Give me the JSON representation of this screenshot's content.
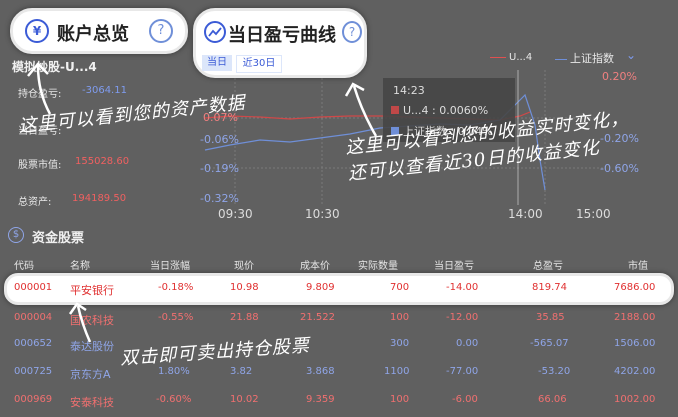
{
  "tabs": {
    "account": "账户总览",
    "pnl": "当日盈亏曲线",
    "period_today": "当日",
    "period_30": "近30日"
  },
  "account": {
    "name": "模拟炒股-U...4",
    "position_label": "持仓盈亏:",
    "position_value": "-3064.11",
    "daily_label": "当日盈亏:",
    "market_label": "股票市值:",
    "market_value": "155028.60",
    "total_label": "总资产:",
    "total_value": "194189.50"
  },
  "chart": {
    "legend_series1": "U...4",
    "legend_series2": "上证指数",
    "tooltip_time": "14:23",
    "tooltip_series1": "U...4 : 0.0060%",
    "tooltip_series2": "上证指数 : 0.04%",
    "left_ticks": [
      "0.07%",
      "-0.06%",
      "-0.19%",
      "-0.32%"
    ],
    "right_ticks": [
      "0.20%",
      "-0.20%",
      "-0.60%"
    ],
    "x_ticks": [
      "09:30",
      "10:30",
      "14:00",
      "15:00"
    ]
  },
  "chart_data": {
    "type": "line",
    "x_ticks": [
      "09:30",
      "10:30",
      "14:00",
      "15:00"
    ],
    "series": [
      {
        "name": "U...4",
        "color": "#e05050"
      },
      {
        "name": "上证指数",
        "color": "#6f8fd8"
      }
    ],
    "tooltip": {
      "time": "14:23",
      "values": [
        "0.0060%",
        "0.04%"
      ]
    }
  },
  "holdings": {
    "title": "资金股票",
    "columns": [
      "代码",
      "名称",
      "当日涨幅",
      "现价",
      "成本价",
      "实际数量",
      "当日盈亏",
      "总盈亏",
      "市值"
    ],
    "rows": [
      [
        "000001",
        "平安银行",
        "-0.18%",
        "10.98",
        "9.809",
        "700",
        "-14.00",
        "819.74",
        "7686.00"
      ],
      [
        "000004",
        "国农科技",
        "-0.55%",
        "21.88",
        "21.522",
        "100",
        "-12.00",
        "35.85",
        "2188.00"
      ],
      [
        "000652",
        "泰达股份",
        "",
        "",
        "",
        "300",
        "0.00",
        "-565.07",
        "1506.00"
      ],
      [
        "000725",
        "京东方A",
        "1.80%",
        "3.82",
        "3.868",
        "1100",
        "-77.00",
        "-53.20",
        "4202.00"
      ],
      [
        "000969",
        "安泰科技",
        "-0.60%",
        "10.02",
        "9.359",
        "100",
        "-6.00",
        "66.06",
        "1002.00"
      ]
    ]
  },
  "notes": {
    "assets": "这里可以看到您的资产数据",
    "pnl": "这里可以看到您的收益实时变化，还可以查看近30日的收益变化",
    "trade": "双击即可卖出持仓股票"
  },
  "colors": {
    "red": "#e03030",
    "blue": "#3a4fb0",
    "highlight_border": "#e8e8e8"
  }
}
